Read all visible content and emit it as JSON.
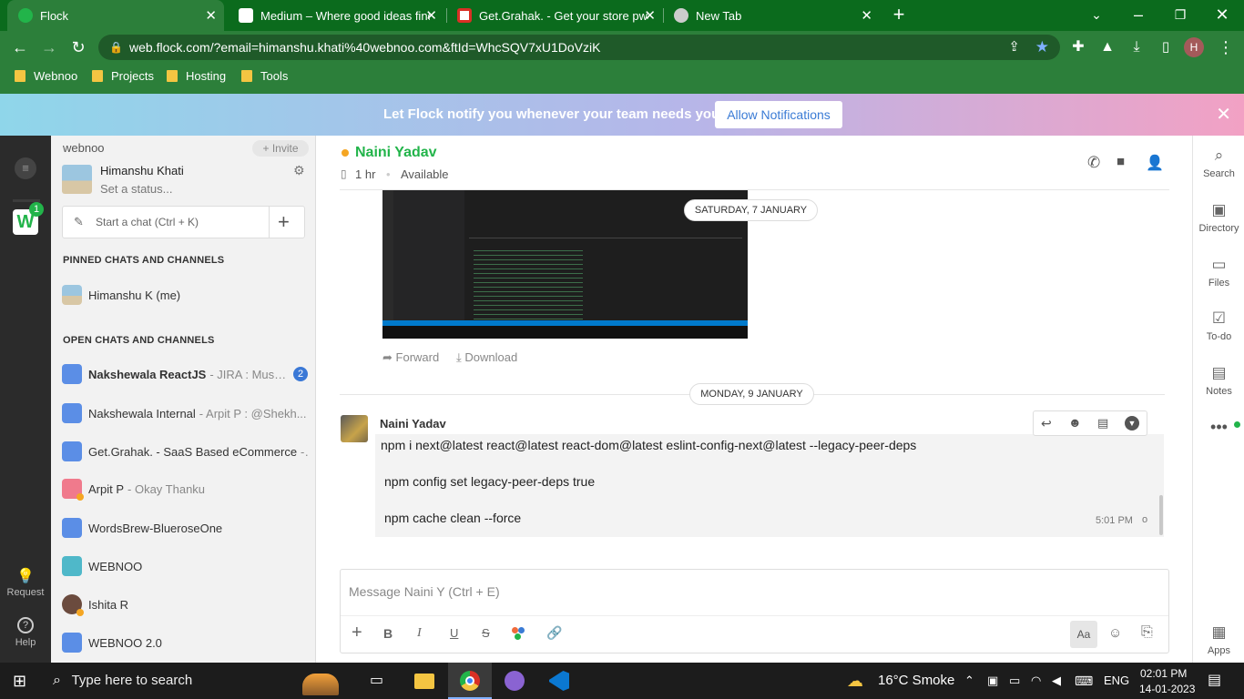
{
  "browser": {
    "tabs": [
      {
        "title": "Flock",
        "color": "#22b44a"
      },
      {
        "title": "Medium – Where good ideas find",
        "color": "#111111"
      },
      {
        "title": "Get.Grahak. - Get your store pwa",
        "color": "#d93025"
      },
      {
        "title": "New Tab",
        "color": "#ffffff"
      }
    ],
    "url": "web.flock.com/?email=himanshu.khati%40webnoo.com&ftId=WhcSQV7xU1DoVziK",
    "profile_initial": "H",
    "bookmarks": [
      "Webnoo",
      "Projects",
      "Hosting",
      "Tools"
    ]
  },
  "banner": {
    "message": "Let Flock notify you whenever your team needs you.",
    "allow_label": "Allow Notifications"
  },
  "rail": {
    "workspace_initial": "W",
    "workspace_badge": "1",
    "request_label": "Request",
    "help_label": "Help"
  },
  "sidebar": {
    "team": "webnoo",
    "invite_label": "+ Invite",
    "user_name": "Himanshu Khati",
    "status_placeholder": "Set a status...",
    "start_chat_placeholder": "Start a chat (Ctrl + K)",
    "pinned_header": "PINNED CHATS AND CHANNELS",
    "pinned": [
      {
        "name": "Himanshu K (me)"
      }
    ],
    "open_header": "OPEN CHATS AND CHANNELS",
    "open": [
      {
        "name": "Nakshewala ReactJS",
        "sub": "- JIRA : Musk...",
        "badge": "2",
        "bold": true
      },
      {
        "name": "Nakshewala Internal",
        "sub": "- Arpit P : @Shekh..."
      },
      {
        "name": "Get.Grahak. - SaaS Based eCommerce",
        "sub": "-..."
      },
      {
        "name": "Arpit P",
        "sub": "- Okay Thanku"
      },
      {
        "name": "WordsBrew-BlueroseOne",
        "sub": ""
      },
      {
        "name": "WEBNOO",
        "sub": ""
      },
      {
        "name": "Ishita R",
        "sub": ""
      },
      {
        "name": "WEBNOO 2.0",
        "sub": ""
      }
    ]
  },
  "chat": {
    "contact_name": "Naini Yadav",
    "local_time": "1 hr",
    "availability": "Available",
    "date_divider_1": "SATURDAY, 7 JANUARY",
    "forward_label": "Forward",
    "download_label": "Download",
    "date_divider_2": "MONDAY, 9 JANUARY",
    "message": {
      "sender": "Naini Yadav",
      "lines": [
        "npm i next@latest react@latest react-dom@latest eslint-config-next@latest --legacy-peer-deps",
        "npm config set legacy-peer-deps true",
        "npm cache clean --force"
      ],
      "time": "5:01 PM"
    },
    "composer_placeholder": "Message Naini Y (Ctrl + E)",
    "format_label": "Aa"
  },
  "right_rail": [
    "Search",
    "Directory",
    "Files",
    "To-do",
    "Notes",
    "Apps"
  ],
  "taskbar": {
    "search_placeholder": "Type here to search",
    "weather": "16°C  Smoke",
    "lang": "ENG",
    "time": "02:01 PM",
    "date": "14-01-2023"
  }
}
